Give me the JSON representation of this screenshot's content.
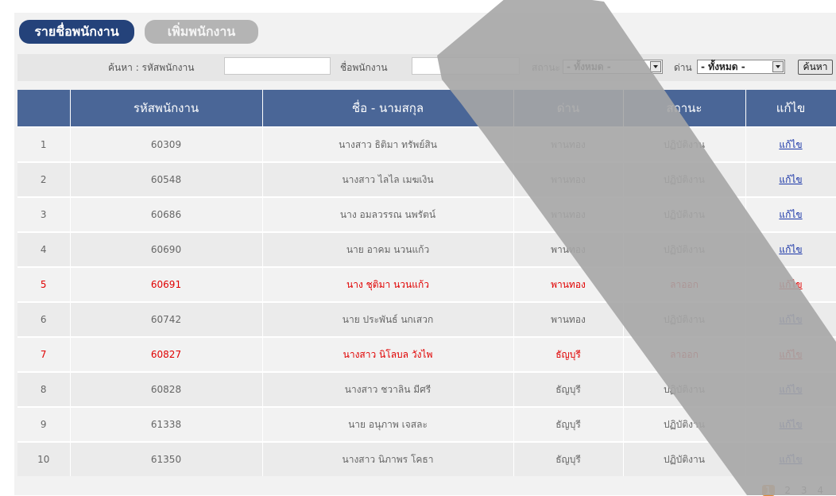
{
  "tabs": {
    "list": "รายชื่อพนักงาน",
    "add": "เพิ่มพนักงาน"
  },
  "search": {
    "id_label": "ค้นหา : รหัสพนักงาน",
    "name_label": "ชื่อพนักงาน",
    "status_label": "สถานะ",
    "status_value": "- ทั้งหมด -",
    "gate_label": "ด่าน",
    "gate_value": "- ทั้งหมด -",
    "button": "ค้นหา"
  },
  "table": {
    "headers": [
      "",
      "รหัสพนักงาน",
      "ชื่อ - นามสกุล",
      "ด่าน",
      "สถานะ",
      "แก้ไข"
    ],
    "rows": [
      {
        "no": "1",
        "id": "60309",
        "name": "นางสาว ธิติมา ทรัพย์สิน",
        "gate": "พานทอง",
        "status": "ปฏิบัติงาน",
        "edit": "แก้ไข"
      },
      {
        "no": "2",
        "id": "60548",
        "name": "นางสาว ไลไล เมฆเงิน",
        "gate": "พานทอง",
        "status": "ปฏิบัติงาน",
        "edit": "แก้ไข"
      },
      {
        "no": "3",
        "id": "60686",
        "name": "นาง อมลวรรณ นพรัตน์",
        "gate": "พานทอง",
        "status": "ปฏิบัติงาน",
        "edit": "แก้ไข"
      },
      {
        "no": "4",
        "id": "60690",
        "name": "นาย อาคม นวนแก้ว",
        "gate": "พานทอง",
        "status": "ปฏิบัติงาน",
        "edit": "แก้ไข"
      },
      {
        "no": "5",
        "id": "60691",
        "name": "นาง ชุติมา นวนแก้ว",
        "gate": "พานทอง",
        "status": "ลาออก",
        "edit": "แก้ไข"
      },
      {
        "no": "6",
        "id": "60742",
        "name": "นาย ประพันธ์ นกเสวก",
        "gate": "พานทอง",
        "status": "ปฏิบัติงาน",
        "edit": "แก้ไข"
      },
      {
        "no": "7",
        "id": "60827",
        "name": "นางสาว นิโลบล วังไพ",
        "gate": "ธัญบุรี",
        "status": "ลาออก",
        "edit": "แก้ไข"
      },
      {
        "no": "8",
        "id": "60828",
        "name": "นางสาว ชวาลิน มีศรี",
        "gate": "ธัญบุรี",
        "status": "ปฏิบัติงาน",
        "edit": "แก้ไข"
      },
      {
        "no": "9",
        "id": "61338",
        "name": "นาย อนุภาพ เจสละ",
        "gate": "ธัญบุรี",
        "status": "ปฏิบัติงาน",
        "edit": "แก้ไข"
      },
      {
        "no": "10",
        "id": "61350",
        "name": "นางสาว นิภาพร โคธา",
        "gate": "ธัญบุรี",
        "status": "ปฏิบัติงาน",
        "edit": "แก้ไข"
      }
    ]
  },
  "pagination": [
    "1",
    "2",
    "3",
    "4"
  ],
  "colors": {
    "header_bg": "#4a6697",
    "tab_active": "#24427a",
    "resigned_text": "#e00000",
    "current_page": "#e58a33"
  }
}
